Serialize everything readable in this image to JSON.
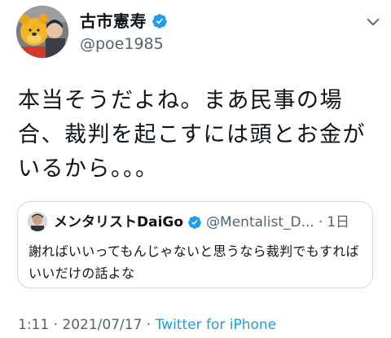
{
  "author": {
    "display_name": "古市憲寿",
    "handle": "@poe1985",
    "verified": true
  },
  "tweet": {
    "text": "本当そうだよね。まあ民事の場合、裁判を起こすには頭とお金がいるから。。。"
  },
  "quoted_tweet": {
    "display_name": "メンタリストDaiGo",
    "handle": "@Mentalist_D...",
    "separator": "·",
    "time": "1日",
    "text": "謝ればいいってもんじゃないと思うなら裁判でもすればいいだけの話よな"
  },
  "meta": {
    "time": "1:11",
    "date": "2021/07/17",
    "separator": "·",
    "source": "Twitter for iPhone"
  },
  "colors": {
    "verified": "#1d9bf0",
    "link": "#1d9bf0",
    "secondary_text": "#536471",
    "border": "#cfd9de"
  },
  "icons": {
    "more_menu": "chevron-down-icon",
    "verified": "verified-badge-icon"
  }
}
